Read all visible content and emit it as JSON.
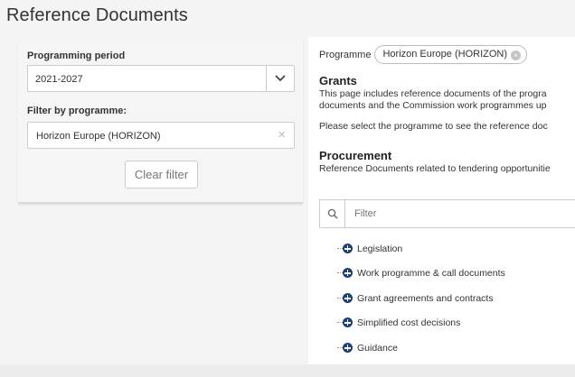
{
  "page": {
    "title": "Reference Documents"
  },
  "filters": {
    "period_label": "Programming period",
    "period_value": "2021-2027",
    "programme_label": "Filter by programme:",
    "programme_value": "Horizon Europe (HORIZON)",
    "clear_x": "×",
    "clear_button": "Clear filter"
  },
  "content": {
    "programme_label": "Programme",
    "programme_chip": "Horizon Europe (HORIZON)",
    "chip_close": "×",
    "grants": {
      "title": "Grants",
      "line1": "This page includes reference documents of the progra",
      "line2": "documents and the Commission work programmes up",
      "line3": "Please select the programme to see the reference doc"
    },
    "procurement": {
      "title": "Procurement",
      "line1": "Reference Documents related to tendering opportunitie"
    },
    "search": {
      "placeholder": "Filter"
    },
    "tree": [
      {
        "label": "Legislation"
      },
      {
        "label": "Work programme & call documents"
      },
      {
        "label": "Grant agreements and contracts"
      },
      {
        "label": "Simplified cost decisions"
      },
      {
        "label": "Guidance"
      }
    ]
  },
  "colors": {
    "accent": "#1d3f73",
    "background": "#f4f4f4",
    "border": "#cccccc"
  },
  "icons": {
    "select": "chevron-down-icon",
    "clear": "close-icon",
    "chip_remove": "close-circle-icon",
    "search": "search-icon",
    "tree_expand": "plus-circle-icon"
  }
}
